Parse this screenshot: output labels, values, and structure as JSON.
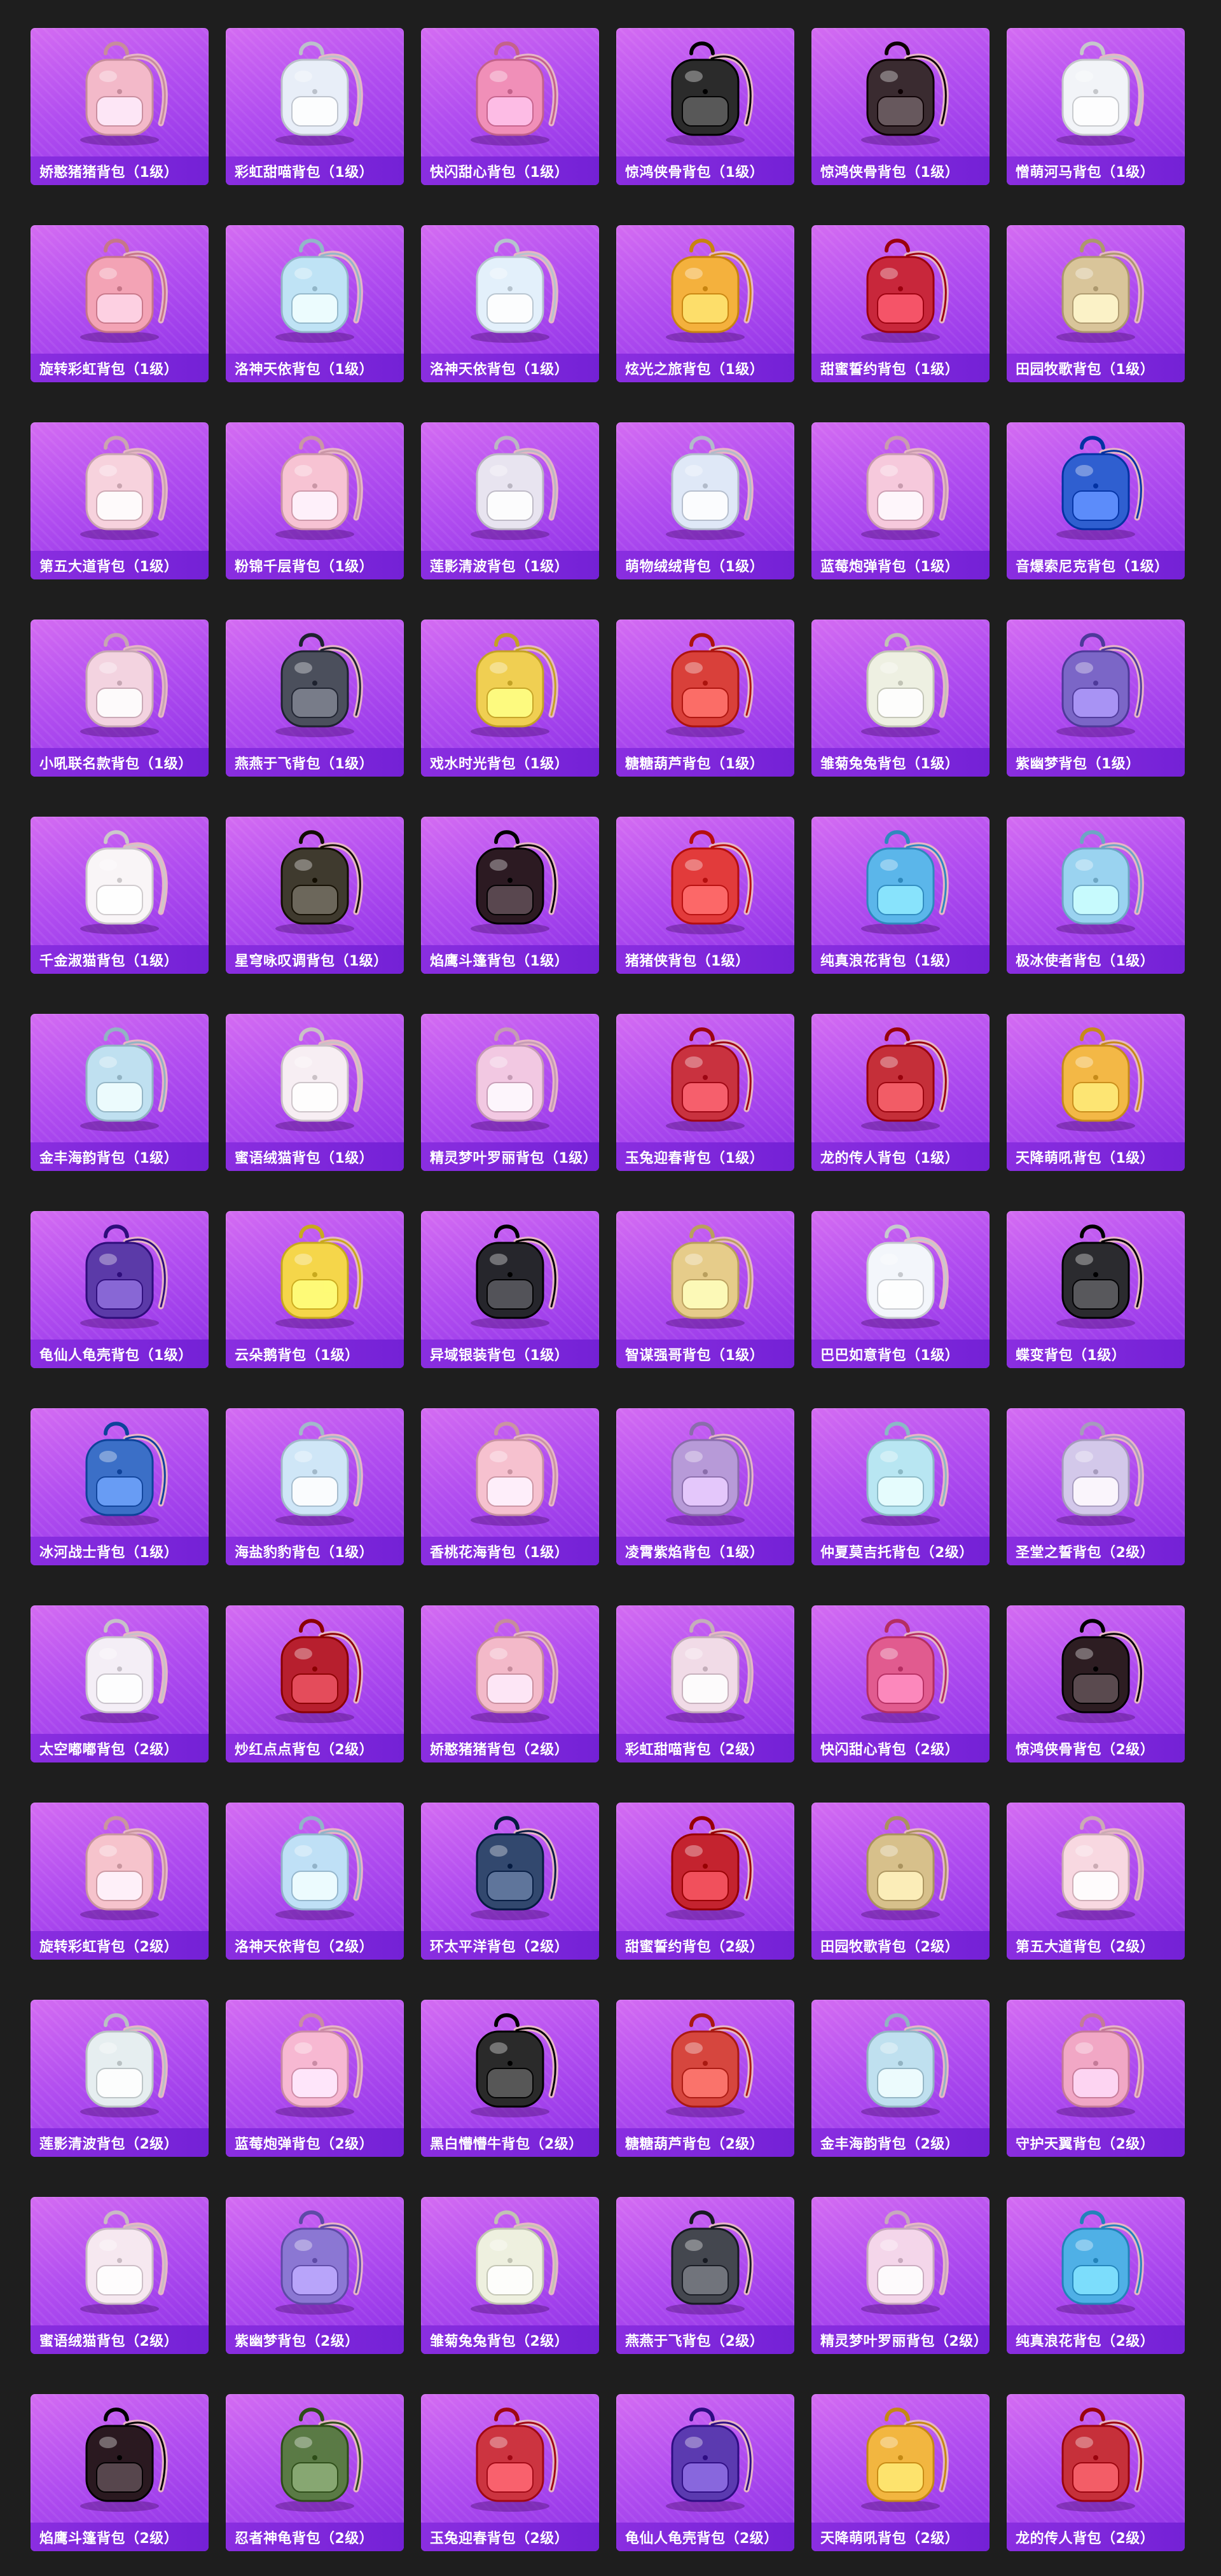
{
  "items": [
    {
      "name": "娇憨猪猪背包（1级）",
      "icon": "pig-backpack-icon",
      "color": "#f3b9c9"
    },
    {
      "name": "彩虹甜喵背包（1级）",
      "icon": "cat-backpack-icon",
      "color": "#e8eef8"
    },
    {
      "name": "快闪甜心背包（1级）",
      "icon": "camera-backpack-icon",
      "color": "#f08fb8"
    },
    {
      "name": "惊鸿侠骨背包（1级）",
      "icon": "helmet-backpack-icon",
      "color": "#2b2b2b"
    },
    {
      "name": "惊鸿侠骨背包（1级）",
      "icon": "armor-backpack-icon",
      "color": "#3a2b30"
    },
    {
      "name": "憎萌河马背包（1级）",
      "icon": "hippo-backpack-icon",
      "color": "#f2f4f8"
    },
    {
      "name": "旋转彩虹背包（1级）",
      "icon": "dress-backpack-icon",
      "color": "#f3a3b5"
    },
    {
      "name": "洛神天依背包（1级）",
      "icon": "helmet-backpack-icon",
      "color": "#bfe3f5"
    },
    {
      "name": "洛神天依背包（1级）",
      "icon": "ribbon-backpack-icon",
      "color": "#e3f0fb"
    },
    {
      "name": "炫光之旅背包（1级）",
      "icon": "arcade-backpack-icon",
      "color": "#f4b13d"
    },
    {
      "name": "甜蜜誓约背包（1级）",
      "icon": "heart-backpack-icon",
      "color": "#c8273b"
    },
    {
      "name": "田园牧歌背包（1级）",
      "icon": "basket-backpack-icon",
      "color": "#d9c59a"
    },
    {
      "name": "第五大道背包（1级）",
      "icon": "quilted-backpack-icon",
      "color": "#f7d2dd"
    },
    {
      "name": "粉锦千层背包（1级）",
      "icon": "bow-backpack-icon",
      "color": "#f7c3d3"
    },
    {
      "name": "莲影清波背包（1级）",
      "icon": "lace-backpack-icon",
      "color": "#e8e4f0"
    },
    {
      "name": "萌物绒绒背包（1级）",
      "icon": "plush-backpack-icon",
      "color": "#dfe8f7"
    },
    {
      "name": "蓝莓炮弹背包（1级）",
      "icon": "cake-backpack-icon",
      "color": "#f6c9dc"
    },
    {
      "name": "音爆索尼克背包（1级）",
      "icon": "sonic-backpack-icon",
      "color": "#2f5fd0"
    },
    {
      "name": "小吼联名款背包（1级）",
      "icon": "bunny-backpack-icon",
      "color": "#f3d3e0"
    },
    {
      "name": "燕燕于飞背包（1级）",
      "icon": "orb-backpack-icon",
      "color": "#4b4f5c"
    },
    {
      "name": "戏水时光背包（1级）",
      "icon": "duck-backpack-icon",
      "color": "#f0cf52"
    },
    {
      "name": "糖糖葫芦背包（1级）",
      "icon": "gourd-backpack-icon",
      "color": "#d9403a"
    },
    {
      "name": "雏菊兔兔背包（1级）",
      "icon": "daisy-backpack-icon",
      "color": "#eef0e2"
    },
    {
      "name": "紫幽梦背包（1级）",
      "icon": "ghost-backpack-icon",
      "color": "#7b66c7"
    },
    {
      "name": "千金淑猫背包（1级）",
      "icon": "kitty-backpack-icon",
      "color": "#f9f5f7"
    },
    {
      "name": "星穹咏叹调背包（1级）",
      "icon": "star-backpack-icon",
      "color": "#3f3a2e"
    },
    {
      "name": "焰鹰斗篷背包（1级）",
      "icon": "cloak-backpack-icon",
      "color": "#2c1a22"
    },
    {
      "name": "猪猪侠背包（1级）",
      "icon": "pighero-backpack-icon",
      "color": "#e23b3b"
    },
    {
      "name": "纯真浪花背包（1级）",
      "icon": "cup-backpack-icon",
      "color": "#5bb6ea"
    },
    {
      "name": "极冰使者背包（1级）",
      "icon": "ice-backpack-icon",
      "color": "#9ad3f0"
    },
    {
      "name": "金丰海韵背包（1级）",
      "icon": "bottle-backpack-icon",
      "color": "#bfe0f0"
    },
    {
      "name": "蜜语绒猫背包（1级）",
      "icon": "fluffy-backpack-icon",
      "color": "#f7eef3"
    },
    {
      "name": "精灵梦叶罗丽背包（1级）",
      "icon": "fairy-backpack-icon",
      "color": "#f2c8e2"
    },
    {
      "name": "玉兔迎春背包（1级）",
      "icon": "festive-backpack-icon",
      "color": "#c9323f"
    },
    {
      "name": "龙的传人背包（1级）",
      "icon": "dragon-backpack-icon",
      "color": "#c52f39"
    },
    {
      "name": "天降萌吼背包（1级）",
      "icon": "tiger-backpack-icon",
      "color": "#f3b846"
    },
    {
      "name": "龟仙人龟壳背包（1级）",
      "icon": "shell-backpack-icon",
      "color": "#5b3aa8"
    },
    {
      "name": "云朵鹅背包（1级）",
      "icon": "flower-backpack-icon",
      "color": "#f5d64a"
    },
    {
      "name": "异域银装背包（1级）",
      "icon": "tech-backpack-icon",
      "color": "#26262c"
    },
    {
      "name": "智谋强哥背包（1级）",
      "icon": "bear-backpack-icon",
      "color": "#e6cc8a"
    },
    {
      "name": "巴巴如意背包（1级）",
      "icon": "rabbit-backpack-icon",
      "color": "#f3f6fb"
    },
    {
      "name": "蝶变背包（1级）",
      "icon": "butterfly-backpack-icon",
      "color": "#2b2b2f"
    },
    {
      "name": "冰河战士背包（1级）",
      "icon": "warrior-backpack-icon",
      "color": "#3b6fc7"
    },
    {
      "name": "海盐豹豹背包（1级）",
      "icon": "leopard-backpack-icon",
      "color": "#cfe6f7"
    },
    {
      "name": "香桃花海背包（1级）",
      "icon": "shellbag-backpack-icon",
      "color": "#f6c1cf"
    },
    {
      "name": "凌霄紫焰背包（1级）",
      "icon": "flame-backpack-icon",
      "color": "#b79ad8"
    },
    {
      "name": "仲夏莫吉托背包（2级）",
      "icon": "mojito-backpack-icon",
      "color": "#b8e6f2"
    },
    {
      "name": "圣堂之誓背包（2级）",
      "icon": "wing-backpack-icon",
      "color": "#d3c8ea"
    },
    {
      "name": "太空嘟嘟背包（2级）",
      "icon": "space-backpack-icon",
      "color": "#f4eef6"
    },
    {
      "name": "炒红点点背包（2级）",
      "icon": "ladybug-backpack-icon",
      "color": "#b71f2e"
    },
    {
      "name": "娇憨猪猪背包（2级）",
      "icon": "pig-backpack-icon",
      "color": "#f3b9c9"
    },
    {
      "name": "彩虹甜喵背包（2级）",
      "icon": "cat-backpack-icon",
      "color": "#f1dbe7"
    },
    {
      "name": "快闪甜心背包（2级）",
      "icon": "camera-backpack-icon",
      "color": "#e15b8f"
    },
    {
      "name": "惊鸿侠骨背包（2级）",
      "icon": "armor-backpack-icon",
      "color": "#2d1d22"
    },
    {
      "name": "旋转彩虹背包（2级）",
      "icon": "dress-backpack-icon",
      "color": "#f6c3cc"
    },
    {
      "name": "洛神天依背包（2级）",
      "icon": "ribbon-backpack-icon",
      "color": "#bfe0f6"
    },
    {
      "name": "环太平洋背包（2级）",
      "icon": "mech-backpack-icon",
      "color": "#32486e"
    },
    {
      "name": "甜蜜誓约背包（2级）",
      "icon": "heart-backpack-icon",
      "color": "#c4232f"
    },
    {
      "name": "田园牧歌背包（2级）",
      "icon": "basket-backpack-icon",
      "color": "#d7c08b"
    },
    {
      "name": "第五大道背包（2级）",
      "icon": "quilted-backpack-icon",
      "color": "#f8d8e1"
    },
    {
      "name": "莲影清波背包（2级）",
      "icon": "lace-backpack-icon",
      "color": "#e6eef0"
    },
    {
      "name": "蓝莓炮弹背包（2级）",
      "icon": "cake-backpack-icon",
      "color": "#f7b8d2"
    },
    {
      "name": "黑白懵懵牛背包（2级）",
      "icon": "cow-backpack-icon",
      "color": "#2a2a2a"
    },
    {
      "name": "糖糖葫芦背包（2级）",
      "icon": "gourd-backpack-icon",
      "color": "#d6463e"
    },
    {
      "name": "金丰海韵背包（2级）",
      "icon": "bottle-backpack-icon",
      "color": "#bfe0ef"
    },
    {
      "name": "守护天翼背包（2级）",
      "icon": "guardian-backpack-icon",
      "color": "#f1a7c5"
    },
    {
      "name": "蜜语绒猫背包（2级）",
      "icon": "fluffy-backpack-icon",
      "color": "#f6e8f0"
    },
    {
      "name": "紫幽梦背包（2级）",
      "icon": "ghost-backpack-icon",
      "color": "#8b77d3"
    },
    {
      "name": "雏菊兔兔背包（2级）",
      "icon": "daisy-backpack-icon",
      "color": "#eef0df"
    },
    {
      "name": "燕燕于飞背包（2级）",
      "icon": "orb-backpack-icon",
      "color": "#44474f"
    },
    {
      "name": "精灵梦叶罗丽背包（2级）",
      "icon": "fairy-backpack-icon",
      "color": "#f4d6ea"
    },
    {
      "name": "纯真浪花背包（2级）",
      "icon": "cup-backpack-icon",
      "color": "#4fb0e6"
    },
    {
      "name": "焰鹰斗篷背包（2级）",
      "icon": "cloak-backpack-icon",
      "color": "#2a1920"
    },
    {
      "name": "忍者神龟背包（2级）",
      "icon": "turtle-backpack-icon",
      "color": "#5a7a45"
    },
    {
      "name": "玉兔迎春背包（2级）",
      "icon": "festive-backpack-icon",
      "color": "#cc3440"
    },
    {
      "name": "龟仙人龟壳背包（2级）",
      "icon": "shell-backpack-icon",
      "color": "#5b3ab0"
    },
    {
      "name": "天降萌吼背包（2级）",
      "icon": "tiger-backpack-icon",
      "color": "#f2b640"
    },
    {
      "name": "龙的传人背包（2级）",
      "icon": "dragon-backpack-icon",
      "color": "#c6303a"
    }
  ]
}
